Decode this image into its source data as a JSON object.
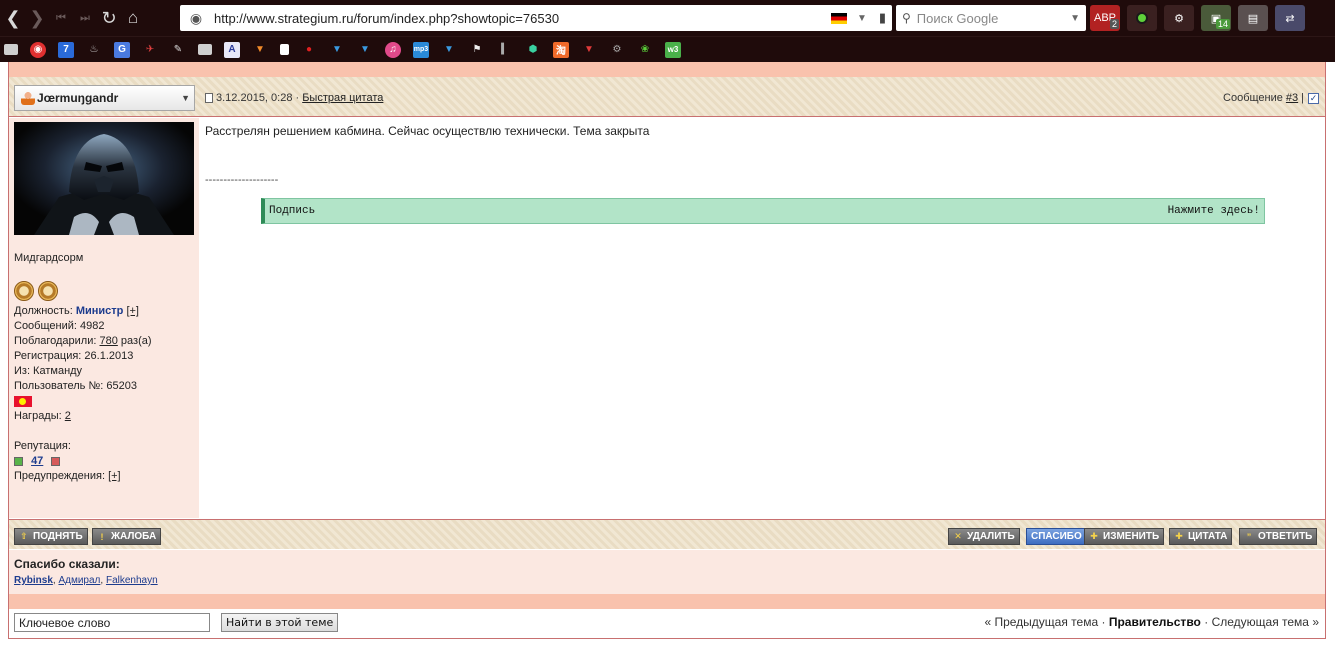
{
  "browser": {
    "url": "http://www.strategium.ru/forum/index.php?showtopic=76530",
    "search_placeholder": "Поиск Google",
    "extensions": [
      {
        "name": "adblock-icon",
        "badge": "2"
      },
      {
        "name": "record-icon",
        "badge": ""
      },
      {
        "name": "wheel-icon",
        "badge": ""
      },
      {
        "name": "tabs-icon",
        "badge": "14"
      },
      {
        "name": "folder-icon",
        "badge": ""
      },
      {
        "name": "sync-icon",
        "badge": ""
      }
    ]
  },
  "post": {
    "author": "Jœrmuŋgandr",
    "date": "3.12.2015, 0:28 ·",
    "quick_quote": "Быстрая цитата",
    "message_label": "Сообщение",
    "message_number": "#3",
    "separator": "|",
    "text": "Расстрелян решением кабмина. Сейчас осуществлю технически. Тема закрыта",
    "signature_separator": "--------------------",
    "signature_label": "Подпись",
    "signature_action": "Нажмите здесь!"
  },
  "user": {
    "title": "Мидгардсорм",
    "position_label": "Должность:",
    "position_value": "Министр",
    "expand": "[+]",
    "posts_label": "Сообщений: 4982",
    "thanked_label": "Поблагодарили:",
    "thanked_count": "780",
    "thanked_suffix": "раз(а)",
    "registration": "Регистрация: 26.1.2013",
    "from": "Из: Катманду",
    "user_number": "Пользователь №: 65203",
    "awards_label": "Награды:",
    "awards_count": "2",
    "reputation_label": "Репутация:",
    "reputation_value": "47",
    "warnings_label": "Предупреждения:"
  },
  "buttons": {
    "raise": "ПОДНЯТЬ",
    "complaint": "ЖАЛОБА",
    "delete": "УДАЛИТЬ",
    "thanks": "СПАСИБО",
    "edit": "ИЗМЕНИТЬ",
    "quote": "ЦИТАТА",
    "reply": "ОТВЕТИТЬ"
  },
  "thanks": {
    "title": "Спасибо сказали:",
    "users": [
      "Rybinsk",
      "Адмирал",
      "Falkenhayn"
    ]
  },
  "footer": {
    "keyword_value": "Ключевое слово",
    "find_button": "Найти в этой теме",
    "prev_topic": "« Предыдущая тема",
    "dot": "·",
    "current_forum": "Правительство",
    "next_topic": "Следующая тема »"
  },
  "colors": {
    "band": "#f9c2ad",
    "user_panel": "#fbe8e1",
    "spoiler": "#b2e4c8",
    "border": "#c87070"
  }
}
